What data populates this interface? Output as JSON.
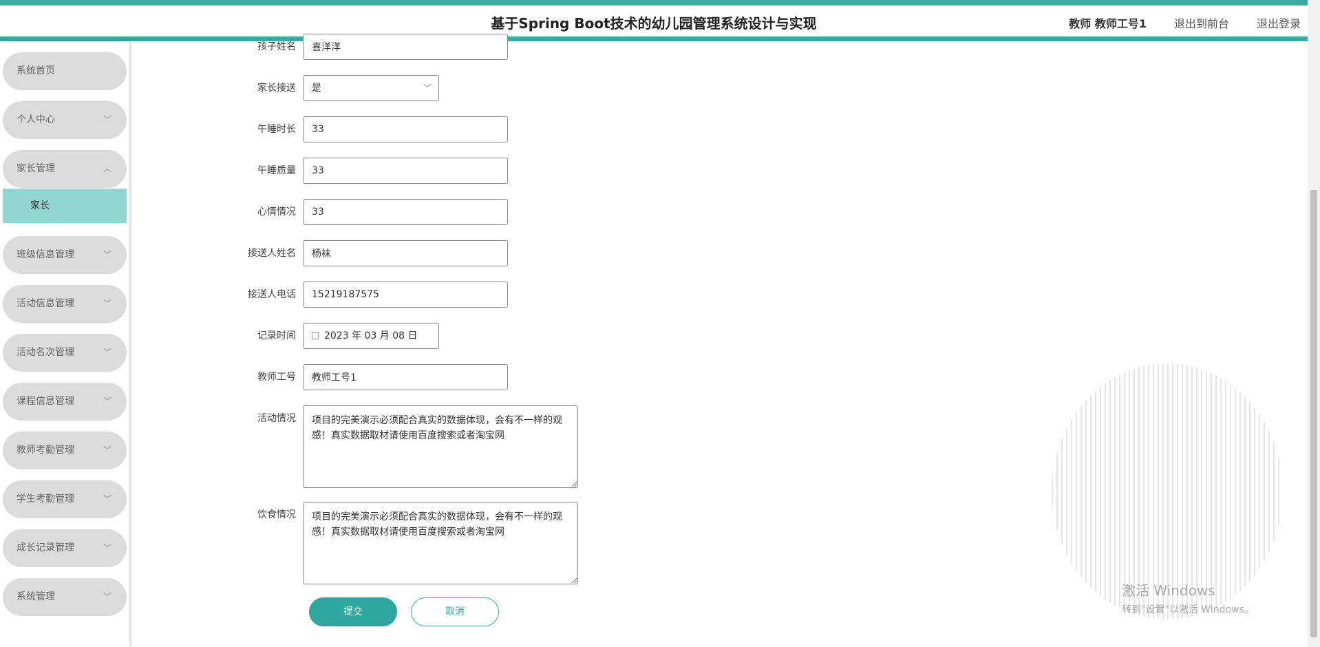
{
  "header": {
    "title": "基于Spring Boot技术的幼儿园管理系统设计与实现",
    "user": "教师 教师工号1",
    "front_link": "退出到前台",
    "logout_link": "退出登录"
  },
  "sidebar": {
    "items": [
      {
        "label": "系统首页"
      },
      {
        "label": "个人中心"
      },
      {
        "label": "家长管理"
      },
      {
        "label": "班级信息管理"
      },
      {
        "label": "活动信息管理"
      },
      {
        "label": "活动名次管理"
      },
      {
        "label": "课程信息管理"
      },
      {
        "label": "教师考勤管理"
      },
      {
        "label": "学生考勤管理"
      },
      {
        "label": "成长记录管理"
      },
      {
        "label": "系统管理"
      }
    ],
    "submenu": {
      "label": "家长"
    }
  },
  "form": {
    "child_name": {
      "label": "孩子姓名",
      "value": "喜洋洋"
    },
    "parent_pickup": {
      "label": "家长接送",
      "value": "是"
    },
    "nap_duration": {
      "label": "午睡时长",
      "value": "33"
    },
    "nap_quality": {
      "label": "午睡质量",
      "value": "33"
    },
    "mood": {
      "label": "心情情况",
      "value": "33"
    },
    "pickup_name": {
      "label": "接送人姓名",
      "value": "杨袜"
    },
    "pickup_phone": {
      "label": "接送人电话",
      "value": "15219187575"
    },
    "record_time": {
      "label": "记录时间",
      "value": "2023 年 03 月 08 日"
    },
    "teacher_id": {
      "label": "教师工号",
      "value": "教师工号1"
    },
    "activity": {
      "label": "活动情况",
      "value": "项目的完美演示必须配合真实的数据体现，会有不一样的观感！真实数据取材请使用百度搜索或者淘宝网"
    },
    "diet": {
      "label": "饮食情况",
      "value": "项目的完美演示必须配合真实的数据体现，会有不一样的观感！真实数据取材请使用百度搜索或者淘宝网"
    },
    "submit_label": "提交",
    "cancel_label": "取消"
  },
  "watermark": {
    "line1": "激活 Windows",
    "line2": "转到\"设置\"以激活 Windows。"
  },
  "colors": {
    "accent": "#3aa99f",
    "submenu_active": "#93d5d0",
    "menu_bg": "#dcdcdc"
  }
}
